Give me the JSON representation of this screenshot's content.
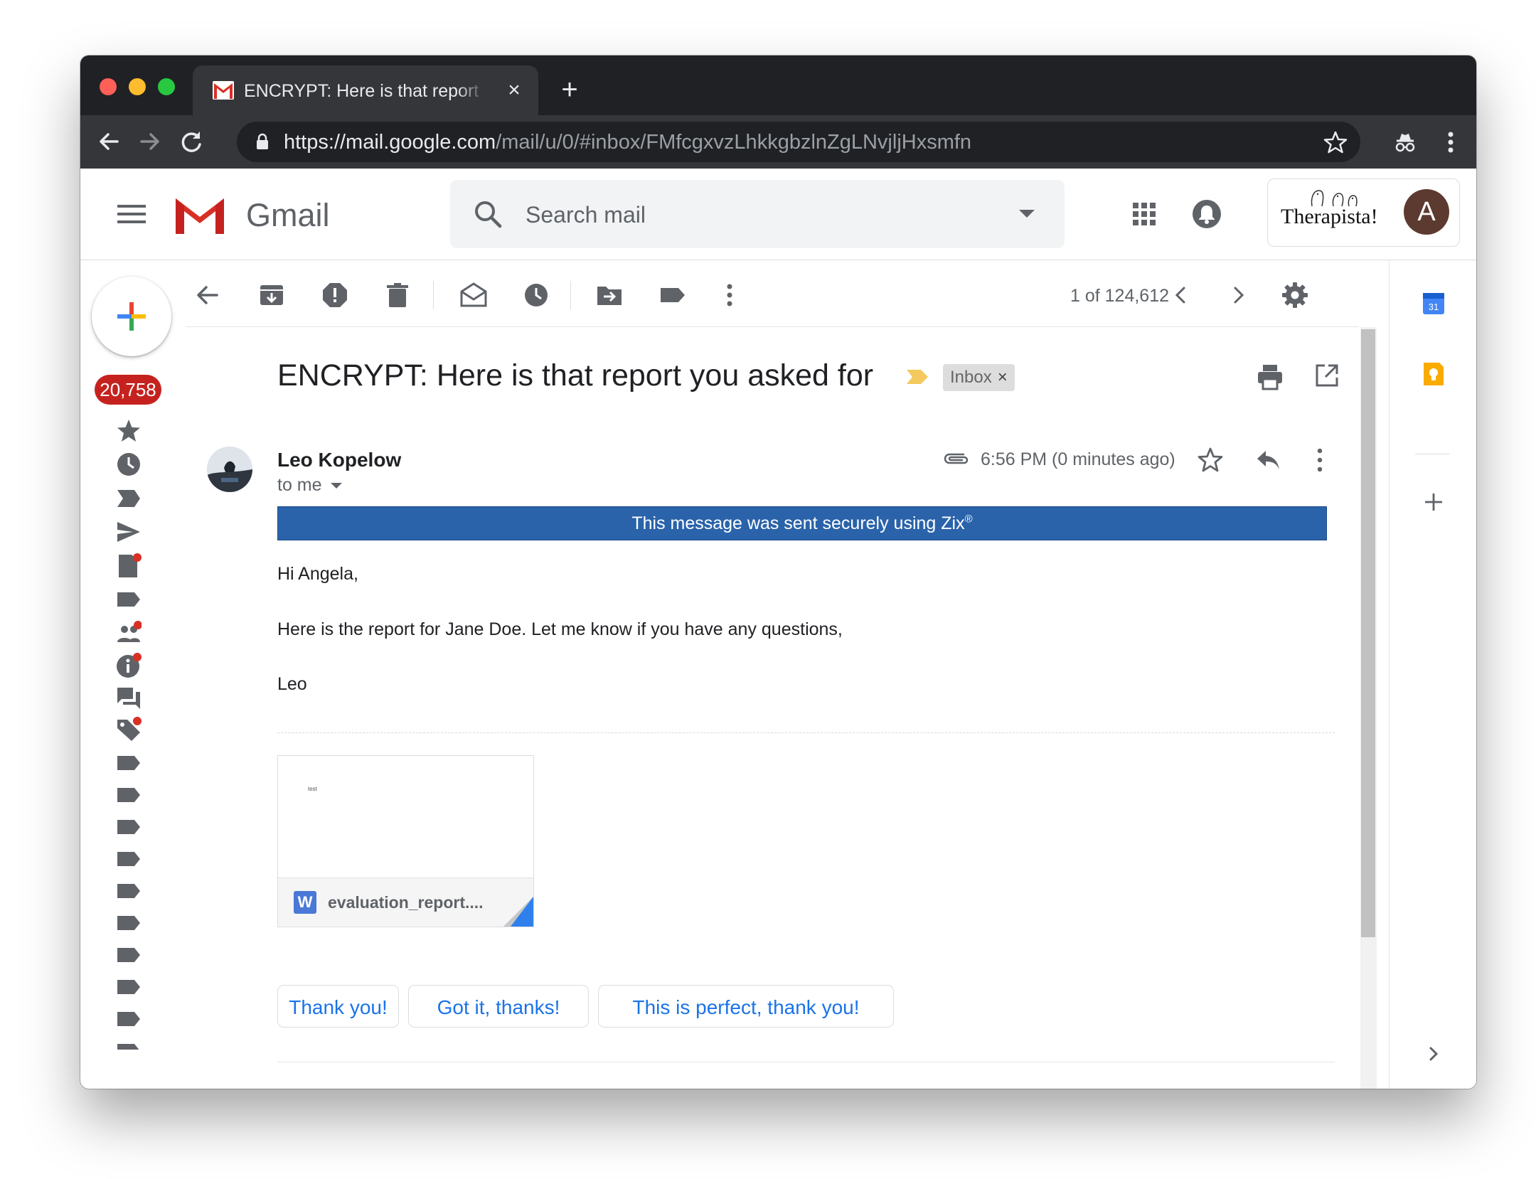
{
  "browser": {
    "tab_title": "ENCRYPT: Here is that report you asked for",
    "tab_close": "×",
    "new_tab": "+",
    "url_host": "https://mail.google.com",
    "url_path": "/mail/u/0/#inbox/FMfcgxvzLhkkgbzlnZgLNvjljHxsmfn"
  },
  "header": {
    "app_name": "Gmail",
    "search_placeholder": "Search mail",
    "brand_text": "Therapista!",
    "account_initial": "A"
  },
  "sidebar": {
    "unread_count": "20,758"
  },
  "toolbar": {
    "pager_text": "1 of 124,612"
  },
  "message": {
    "subject": "ENCRYPT: Here is that report you asked for",
    "label": "Inbox",
    "label_remove": "×",
    "sender": "Leo Kopelow",
    "recipient": "to me",
    "time": "6:56 PM (0 minutes ago)",
    "zix_banner": "This message was sent securely using Zix",
    "zix_mark": "®",
    "body": [
      "Hi Angela,",
      "Here is the report for Jane Doe. Let me know if you have any questions,",
      "Leo"
    ]
  },
  "attachment": {
    "preview_text": "test",
    "type_letter": "W",
    "filename": "evaluation_report...."
  },
  "smart_replies": [
    "Thank you!",
    "Got it, thanks!",
    "This is perfect, thank you!"
  ],
  "side_panel": {
    "calendar_day": "31"
  },
  "colors": {
    "chrome_dark": "#202124",
    "chrome_toolbar": "#35363a",
    "badge_red": "#c5221f",
    "zix_blue": "#2a63aa",
    "link_blue": "#1a73e8",
    "icon_gray": "#5f6368"
  }
}
